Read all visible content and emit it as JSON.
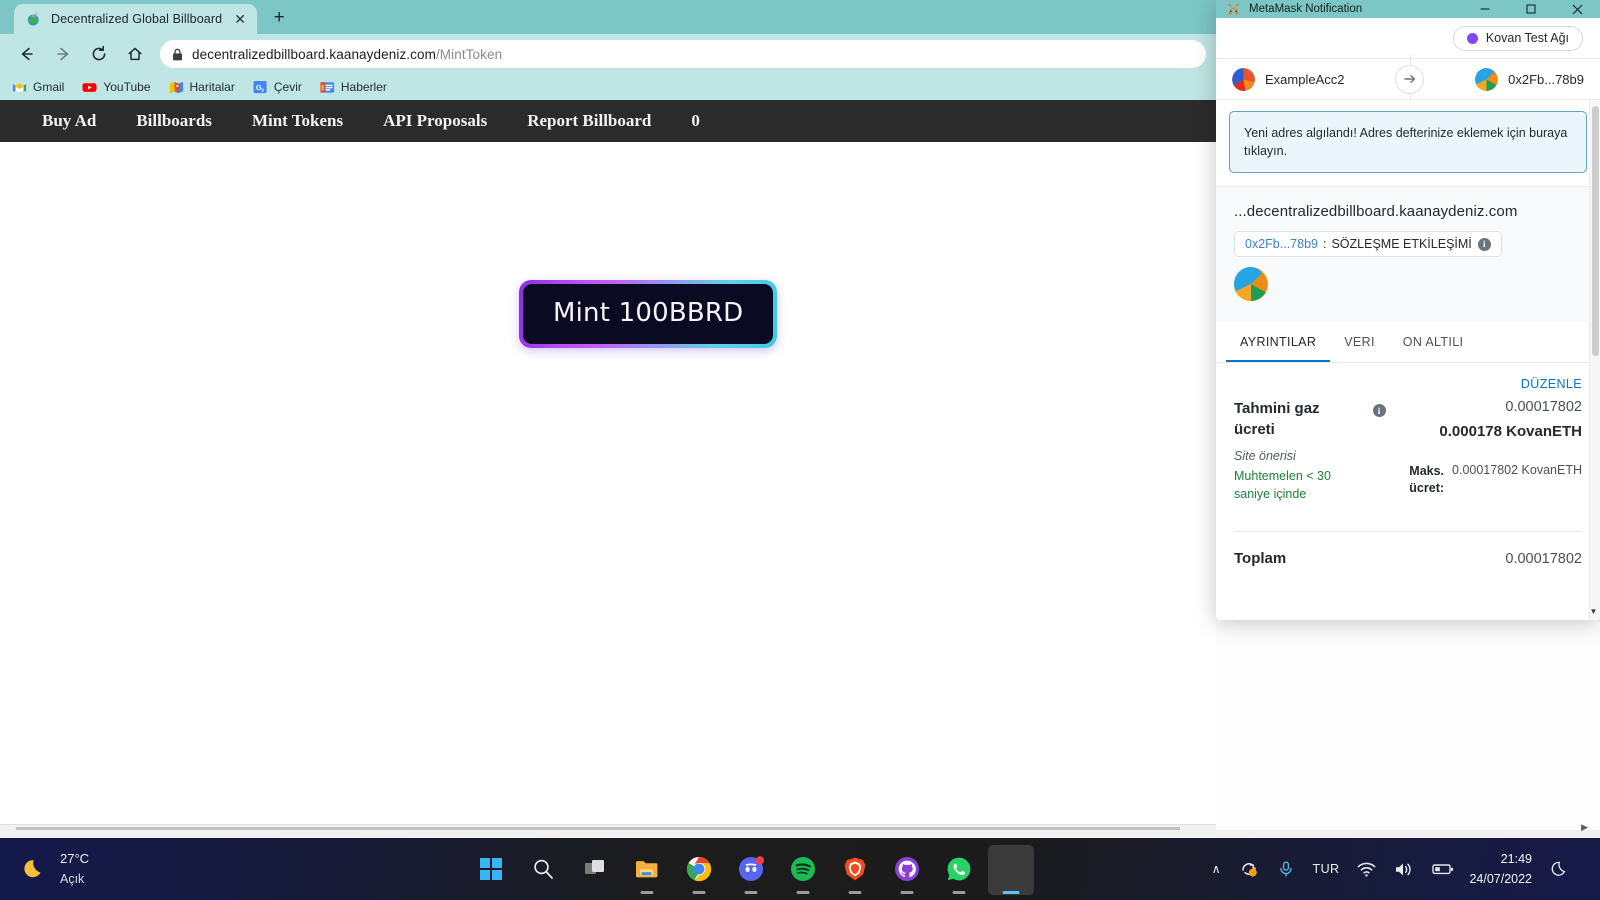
{
  "browser": {
    "tab": {
      "title": "Decentralized Global Billboard",
      "favicon": "globe-icon",
      "close": "✕"
    },
    "newtab_label": "+",
    "nav": {
      "back": "←",
      "forward": "→",
      "reload": "⟳",
      "home": "⌂"
    },
    "omnibox": {
      "lock": "lock-icon",
      "domain": "decentralizedbillboard.kaanaydeniz.com",
      "path": "/MintToken"
    },
    "bookmarks": [
      {
        "label": "Gmail",
        "icon": "gmail-icon"
      },
      {
        "label": "YouTube",
        "icon": "youtube-icon"
      },
      {
        "label": "Haritalar",
        "icon": "maps-icon"
      },
      {
        "label": "Çevir",
        "icon": "translate-icon"
      },
      {
        "label": "Haberler",
        "icon": "news-icon"
      }
    ]
  },
  "site": {
    "nav_items": [
      "Buy Ad",
      "Billboards",
      "Mint Tokens",
      "API Proposals",
      "Report Billboard",
      "0"
    ],
    "mint_button_label": "Mint 100BBRD",
    "colors": {
      "nav_bg": "#2b2b2b",
      "button_fill": "#0a0a23",
      "gradient_start": "#8b2fe0",
      "gradient_end": "#3ec9e6"
    }
  },
  "metamask": {
    "window_title": "MetaMask Notification",
    "window_controls": {
      "minimize": "─",
      "maximize": "□",
      "close": "✕"
    },
    "network": {
      "name": "Kovan Test Ağı",
      "dot_color": "#7e49f3"
    },
    "accounts": {
      "from": "ExampleAcc2",
      "to": "0x2Fb...78b9",
      "arrow": "→"
    },
    "alert": "Yeni adres algılandı! Adres defterinize eklemek için buraya tıklayın.",
    "origin": "...decentralizedbillboard.kaanaydeniz.com",
    "contract": {
      "address": "0x2Fb...78b9",
      "separator": ":",
      "label": "SÖZLEŞME ETKİLEŞİMİ",
      "info": "i"
    },
    "tabs": [
      {
        "label": "AYRINTILAR",
        "active": true
      },
      {
        "label": "VERI",
        "active": false
      },
      {
        "label": "ON ALTILI",
        "active": false
      }
    ],
    "edit_label": "DÜZENLE",
    "gas": {
      "title": "Tahmini gaz ücreti",
      "info": "i",
      "amount": "0.00017802",
      "amount_eth": "0.000178 KovanETH",
      "suggestion_label": "Site önerisi",
      "time_estimate": "Muhtemelen < 30 saniye içinde",
      "max_label": "Maks. ücret:",
      "max_value": "0.00017802 KovanETH"
    },
    "total": {
      "label": "Toplam",
      "value": "0.00017802"
    },
    "scroll_down": "▼"
  },
  "taskbar": {
    "weather": {
      "temp": "27°C",
      "desc": "Açık",
      "icon": "moon-icon"
    },
    "apps": [
      {
        "name": "start-icon",
        "running": false
      },
      {
        "name": "search-icon",
        "running": false
      },
      {
        "name": "task-view-icon",
        "running": false
      },
      {
        "name": "file-explorer-icon",
        "running": true
      },
      {
        "name": "chrome-icon",
        "running": true
      },
      {
        "name": "discord-icon",
        "running": true
      },
      {
        "name": "spotify-icon",
        "running": true
      },
      {
        "name": "brave-icon",
        "running": true
      },
      {
        "name": "github-icon",
        "running": true
      },
      {
        "name": "whatsapp-icon",
        "running": true
      },
      {
        "name": "metamask-icon",
        "running": true
      }
    ],
    "tray": {
      "chevron": "∧",
      "onedrive": "onedrive-sync-icon",
      "mic": "microphone-icon",
      "language": "TUR",
      "wifi": "wifi-icon",
      "volume": "volume-icon",
      "battery": "battery-icon",
      "time": "21:49",
      "date": "24/07/2022",
      "focus": "moon-icon"
    }
  },
  "scrollbars": {
    "page_h_arrow_left": "◀",
    "page_h_arrow_right": "▶"
  }
}
